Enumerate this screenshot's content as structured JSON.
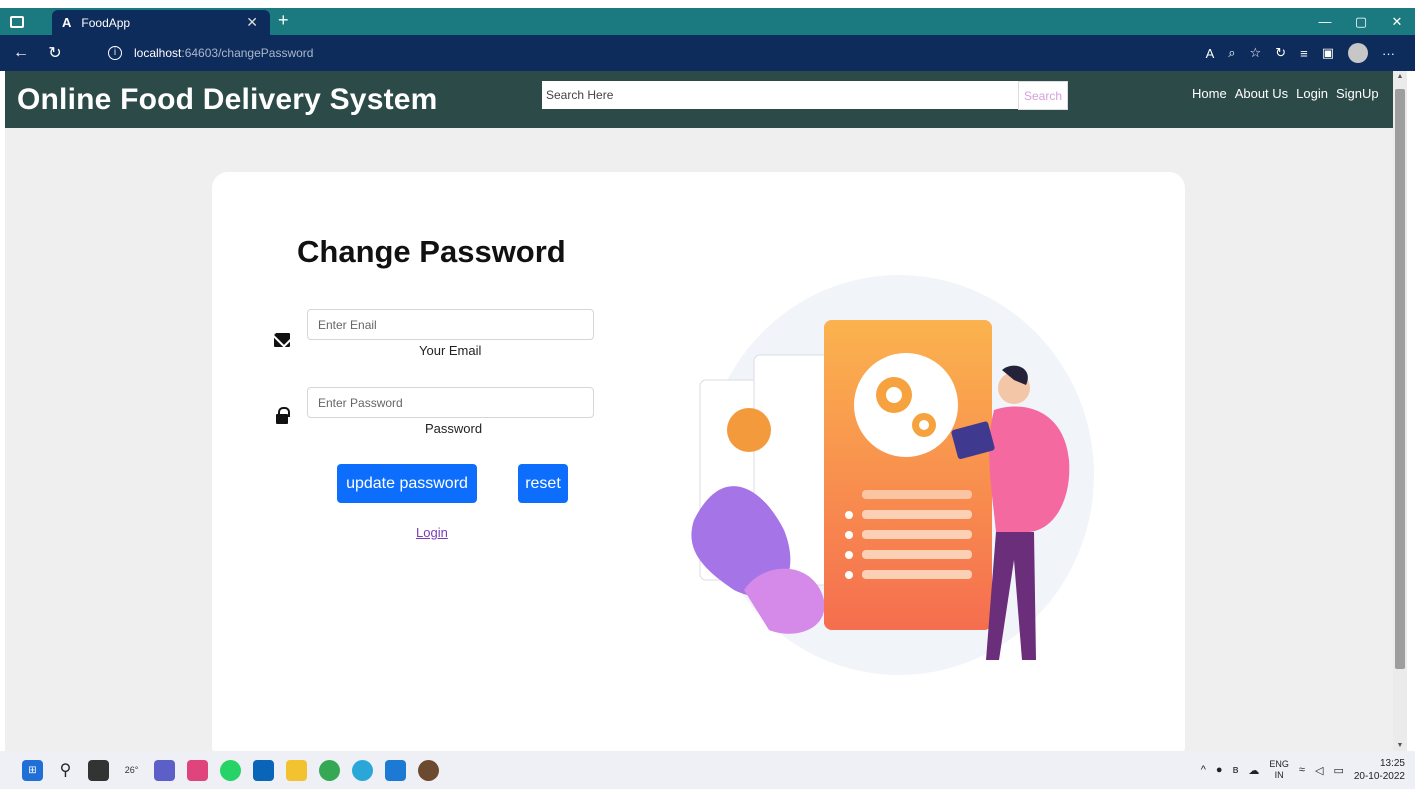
{
  "browser": {
    "tab_title": "FoodApp",
    "tab_icon": "A",
    "url_host": "localhost",
    "url_path": ":64603/changePassword",
    "new_tab_symbol": "+"
  },
  "site": {
    "brand": "Online Food Delivery System",
    "search_placeholder": "Search Here",
    "search_button": "Search",
    "nav": [
      "Home",
      "About Us",
      "Login",
      "SignUp"
    ]
  },
  "form": {
    "title": "Change Password",
    "email_placeholder": "Enter Enail",
    "email_label": "Your Email",
    "password_placeholder": "Enter Password",
    "password_label": "Password",
    "update_button": "update password",
    "reset_button": "reset",
    "login_link": "Login"
  },
  "taskbar": {
    "weather": "26°",
    "language": "ENG",
    "region": "IN",
    "time": "13:25",
    "date": "20-10-2022"
  },
  "colors": {
    "header_bg": "#2c4a47",
    "primary_button": "#0d6efd",
    "browser_titlebar": "#1a7a7f",
    "browser_addressbar": "#0d2b5b"
  }
}
